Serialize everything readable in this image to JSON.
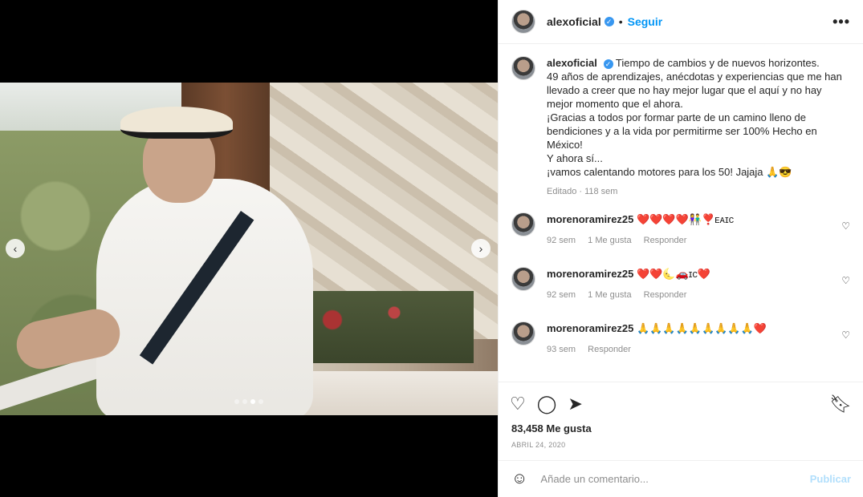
{
  "post": {
    "username": "alexoficial",
    "follow_label": "Seguir",
    "more_label": "•••",
    "caption": "Tiempo de cambios y de nuevos horizontes.\n49 años de aprendizajes, anécdotas y experiencias que me han llevado a creer que no hay mejor lugar que el aquí y no hay mejor momento que el ahora.\n¡Gracias a todos por formar parte de un camino lleno de bendiciones y a la vida por permitirme ser 100% Hecho en México!\nY ahora sí...\n¡vamos calentando motores para los 50! Jajaja 🙏😎",
    "edited_label": "Editado · 118 sem",
    "likes": "83,458 Me gusta",
    "date": "ABRIL 24, 2020"
  },
  "comments": [
    {
      "username": "morenoramirez25",
      "text": "❤️❤️❤️❤️👫❣️ᴇᴀɪᴄ",
      "time": "92 sem",
      "likes": "1 Me gusta",
      "reply": "Responder"
    },
    {
      "username": "morenoramirez25",
      "text": "❤️❤️🌜🚗ɪᴄ❤️",
      "time": "92 sem",
      "likes": "1 Me gusta",
      "reply": "Responder"
    },
    {
      "username": "morenoramirez25",
      "text": "🙏🙏🙏🙏🙏🙏🙏🙏🙏❤️",
      "time": "93 sem",
      "reply": "Responder"
    }
  ],
  "composer": {
    "placeholder": "Añade un comentario...",
    "publish_label": "Publicar"
  },
  "icons": {
    "heart": "heart-icon",
    "comment": "comment-icon",
    "share": "send-icon",
    "save": "bookmark-icon",
    "emoji": "emoji-icon"
  },
  "colors": {
    "accent": "#0095f6",
    "publish_disabled": "#b2dffc",
    "verified": "#3897f0"
  }
}
